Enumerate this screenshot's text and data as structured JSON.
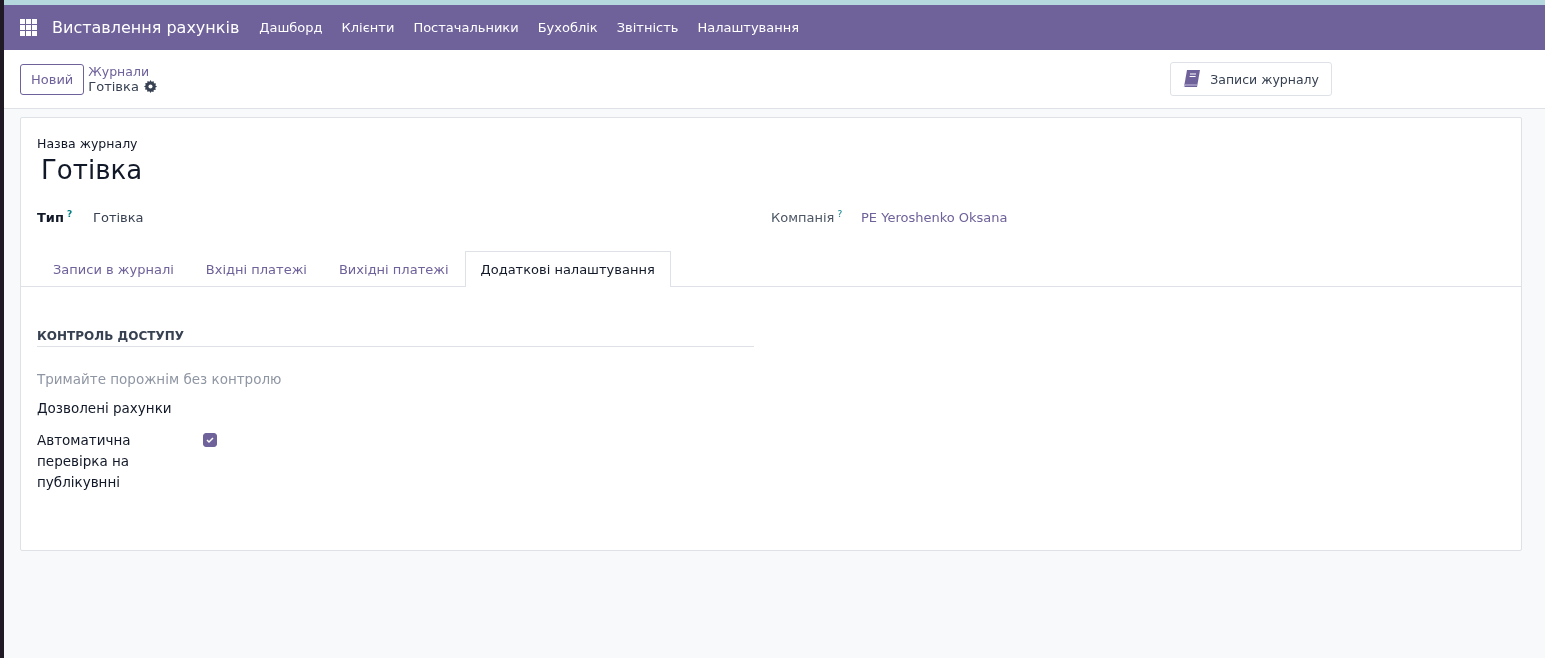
{
  "navbar": {
    "app_title": "Виставлення рахунків",
    "menu": [
      "Дашборд",
      "Клієнти",
      "Постачальники",
      "Бухоблік",
      "Звітність",
      "Налаштування"
    ]
  },
  "control_panel": {
    "new_button": "Новий",
    "breadcrumb": "Журнали",
    "current": "Готівка",
    "smart_button": "Записи журналу"
  },
  "form": {
    "name_label": "Назва журналу",
    "name": "Готівка",
    "fields": [
      {
        "label": "Тип",
        "help": "?",
        "value": "Готівка",
        "kind": "plain"
      },
      {
        "label": "Компанія",
        "help": "?",
        "value": "PE Yeroshenko Oksana",
        "kind": "link"
      }
    ],
    "tabs": [
      {
        "label": "Записи в журналі",
        "selected": false
      },
      {
        "label": "Вхідні платежі",
        "selected": false
      },
      {
        "label": "Вихідні платежі",
        "selected": false
      },
      {
        "label": "Додаткові налаштування",
        "selected": true
      }
    ],
    "section_title": "КОНТРОЛЬ ДОСТУПУ",
    "allowed_accounts": {
      "placeholder": "Тримайте порожнім без контролю",
      "label": "Дозволені рахунки"
    },
    "auto_check": {
      "label": "Автоматична перевірка на публікувнні",
      "checked": true
    }
  }
}
